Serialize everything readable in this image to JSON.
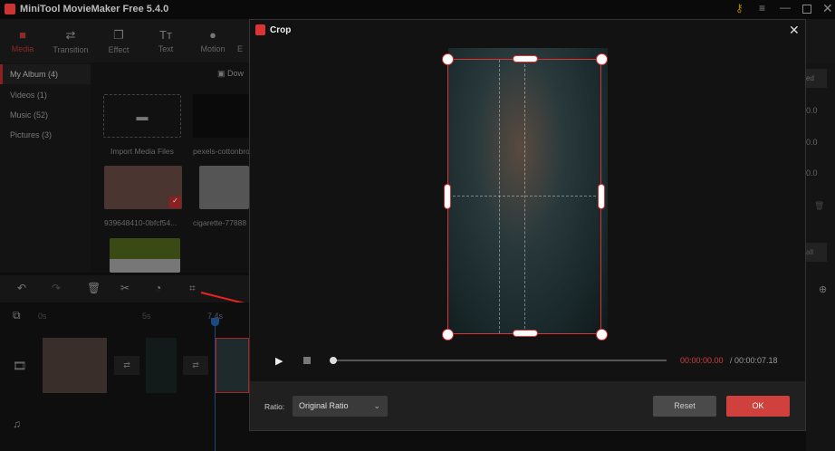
{
  "app": {
    "title": "MiniTool MovieMaker Free 5.4.0"
  },
  "toolbar": [
    {
      "label": "Media",
      "icon": "folder-icon"
    },
    {
      "label": "Transition",
      "icon": "swap-icon"
    },
    {
      "label": "Effect",
      "icon": "effect-icon"
    },
    {
      "label": "Text",
      "icon": "text-icon"
    },
    {
      "label": "Motion",
      "icon": "motion-icon"
    },
    {
      "label": "E"
    }
  ],
  "sidebar": [
    {
      "label": "My Album (4)"
    },
    {
      "label": "Videos (1)"
    },
    {
      "label": "Music (52)"
    },
    {
      "label": "Pictures (3)"
    }
  ],
  "media": {
    "download": "Dow",
    "items": [
      {
        "label": "Import Media Files"
      },
      {
        "label": "pexels-cottonbro"
      },
      {
        "label": "939648410-0bfcf54..."
      },
      {
        "label": "cigarette-77888"
      }
    ]
  },
  "timeline": {
    "ticks": [
      "0s",
      "5s",
      "7.4s"
    ]
  },
  "right_panel": {
    "btn1": "ed",
    "values": [
      "0.0",
      "0.0",
      "0.0"
    ],
    "btn2": "all"
  },
  "dialog": {
    "title": "Crop",
    "time_current": "00:00:00.00",
    "time_total": "/ 00:00:07.18",
    "ratio_label": "Ratio:",
    "ratio_value": "Original Ratio",
    "reset": "Reset",
    "ok": "OK",
    "accent": "#d0403c"
  }
}
